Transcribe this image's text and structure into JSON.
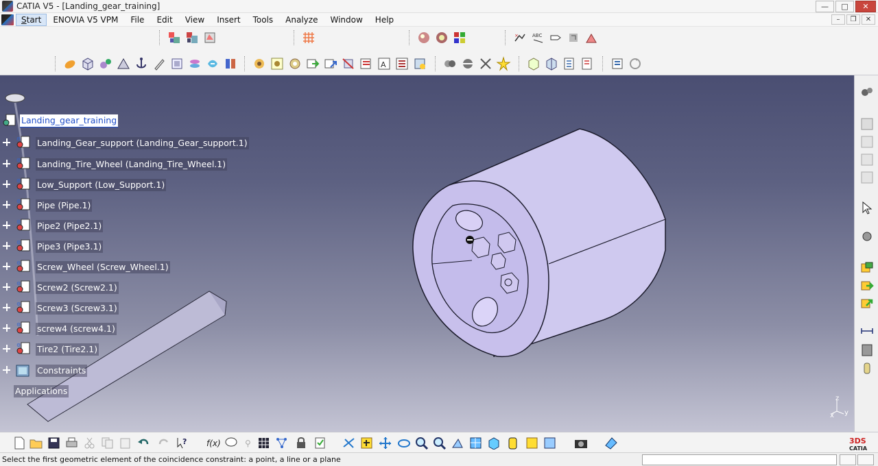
{
  "window": {
    "title": "CATIA V5 - [Landing_gear_training]",
    "minimize": "—",
    "maximize": "□",
    "close": "✕"
  },
  "menubar": {
    "items": [
      "Start",
      "ENOVIA V5 VPM",
      "File",
      "Edit",
      "View",
      "Insert",
      "Tools",
      "Analyze",
      "Window",
      "Help"
    ]
  },
  "tree": {
    "root": "Landing_gear_training",
    "children": [
      "Landing_Gear_support (Landing_Gear_support.1)",
      "Landing_Tire_Wheel (Landing_Tire_Wheel.1)",
      "Low_Support (Low_Support.1)",
      "Pipe (Pipe.1)",
      "Pipe2 (Pipe2.1)",
      "Pipe3 (Pipe3.1)",
      "Screw_Wheel (Screw_Wheel.1)",
      "Screw2 (Screw2.1)",
      "Screw3 (Screw3.1)",
      "screw4 (screw4.1)",
      "Tire2 (Tire2.1)"
    ],
    "constraints": "Constraints",
    "applications": "Applications"
  },
  "compass_axes": {
    "z": "z",
    "x": "x",
    "y": "y"
  },
  "statusbar": {
    "message": "Select the first geometric element of the coincidence constraint: a point, a line or a plane"
  },
  "colors": {
    "viewport_top": "#4a4e72",
    "viewport_bottom": "#c4c4d4",
    "part_fill": "#c9c0ec",
    "selection_blue": "#1f4ec8"
  },
  "brand": {
    "logo_text": "CATIA"
  }
}
